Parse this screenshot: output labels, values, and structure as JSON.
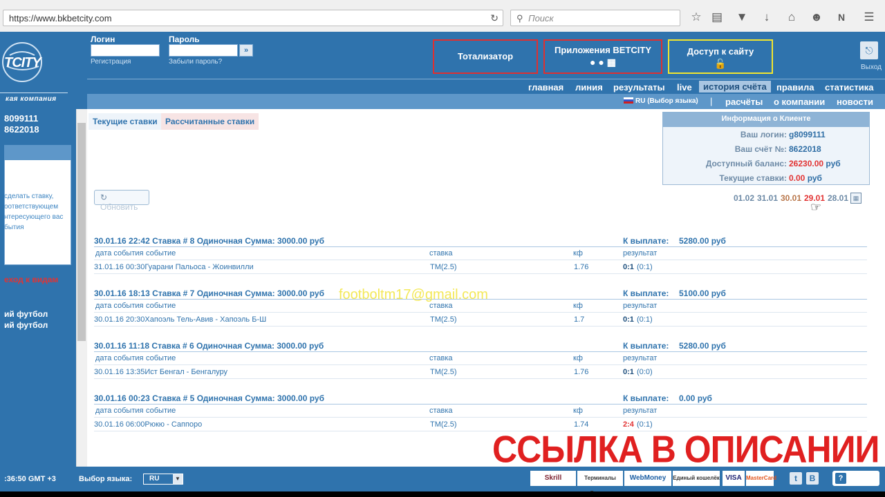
{
  "browser": {
    "url": "https://www.bkbetcity.com",
    "search_placeholder": "Поиск"
  },
  "header": {
    "logo_text": "TCITY",
    "logo_sub": "кая компания",
    "login_label": "Логин",
    "password_label": "Пароль",
    "register_link": "Регистрация",
    "forgot_link": "Забыли пароль?",
    "totalizator": "Тотализатор",
    "apps_label": "Приложения BETCITY",
    "apps_icons": "⚑  ⊞",
    "access_label": "Доступ к сайту",
    "exit_label": "Выход"
  },
  "nav_primary": [
    "главная",
    "линия",
    "результаты",
    "live",
    "история счёта",
    "правила",
    "статистика"
  ],
  "nav_secondary": {
    "lang": "RU (Выбор языка)",
    "items": [
      "расчёты",
      "о компании",
      "новости"
    ]
  },
  "left_panel": {
    "num1": "8099111",
    "num2": "8622018",
    "text_lines": [
      "сделать ставку,",
      "оответствующем",
      "нтересующего вас",
      "бытия"
    ],
    "red_link": "еход к видам",
    "foot1": "ий футбол",
    "foot2": "ий футбол"
  },
  "tabs": {
    "current": "Текущие ставки",
    "settled": "Рассчитанные ставки"
  },
  "refresh_label": "Обновить",
  "client_info": {
    "title": "Информация о Клиенте",
    "login_key": "Ваш логин:",
    "login_val": "g8099111",
    "account_key": "Ваш счёт №:",
    "account_val": "8622018",
    "balance_key": "Доступный баланс:",
    "balance_val": "26230.00",
    "balance_cur": "руб",
    "bets_key": "Текущие ставки:",
    "bets_val": "0.00",
    "bets_cur": "руб"
  },
  "dates": [
    "01.02",
    "31.01",
    "30.01",
    "29.01",
    "28.01"
  ],
  "bets": [
    {
      "header": "30.01.16 22:42  Ставка # 8   Одиночная  Сумма: 3000.00 руб",
      "payout_label": "К выплате:",
      "payout_value": "5280.00 руб",
      "col_date": "дата события",
      "col_event": "событие",
      "col_bet": "ставка",
      "col_kf": "кф",
      "col_result": "результат",
      "event": "31.01.16 00:30Гуарани Пальоса - Жоинвилли",
      "bet": "ТМ(2.5)",
      "kf": "1.76",
      "result_main": "0:1",
      "result_sub": "(0:1)",
      "result_lost": false
    },
    {
      "header": "30.01.16 18:13  Ставка # 7   Одиночная  Сумма: 3000.00 руб",
      "payout_label": "К выплате:",
      "payout_value": "5100.00 руб",
      "col_date": "дата события",
      "col_event": "событие",
      "col_bet": "ставка",
      "col_kf": "кф",
      "col_result": "результат",
      "event": "30.01.16 20:30Хапоэль Тель-Авив - Хапоэль Б-Ш",
      "bet": "ТМ(2.5)",
      "kf": "1.7",
      "result_main": "0:1",
      "result_sub": "(0:1)",
      "result_lost": false
    },
    {
      "header": "30.01.16 11:18  Ставка # 6   Одиночная  Сумма: 3000.00 руб",
      "payout_label": "К выплате:",
      "payout_value": "5280.00 руб",
      "col_date": "дата события",
      "col_event": "событие",
      "col_bet": "ставка",
      "col_kf": "кф",
      "col_result": "результат",
      "event": "30.01.16 13:35Ист Бенгал - Бенгалуру",
      "bet": "ТМ(2.5)",
      "kf": "1.76",
      "result_main": "0:1",
      "result_sub": "(0:0)",
      "result_lost": false
    },
    {
      "header": "30.01.16 00:23  Ставка # 5   Одиночная  Сумма: 3000.00 руб",
      "payout_label": "К выплате:",
      "payout_value": "0.00 руб",
      "col_date": "дата события",
      "col_event": "событие",
      "col_bet": "ставка",
      "col_kf": "кф",
      "col_result": "результат",
      "event": "30.01.16 06:00Рюкю - Саппоро",
      "bet": "ТМ(2.5)",
      "kf": "1.74",
      "result_main": "2:4",
      "result_sub": "(0:1)",
      "result_lost": true
    }
  ],
  "watermark": "footboltm17@gmail.com",
  "promo": "ССЫЛКА В ОПИСАНИИ",
  "footer": {
    "time": ":36:50 GMT +3",
    "lang_label": "Выбор языка:",
    "lang_value": "RU",
    "payments": [
      "Skrill",
      "Терминалы России",
      "WebMoney",
      "Единый кошелёк",
      "VISA",
      "MasterCard"
    ],
    "help": "ПОМОЩЬ"
  },
  "colors": {
    "brand": "#2f73ad",
    "red": "#e23333",
    "orange": "#f39c12"
  }
}
